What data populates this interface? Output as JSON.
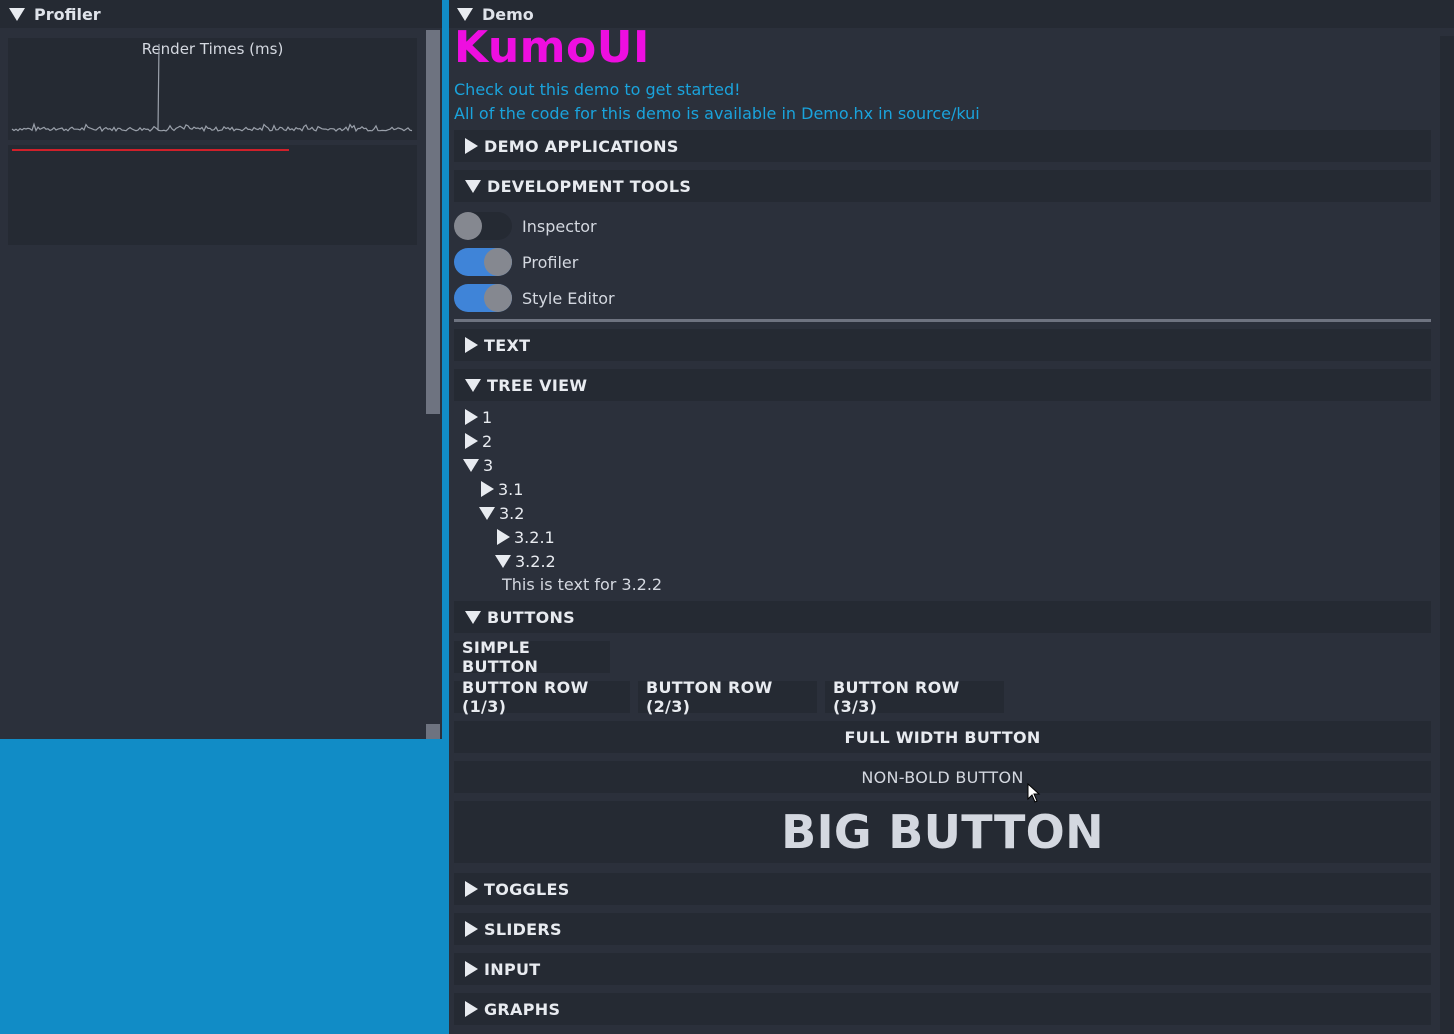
{
  "profiler": {
    "title": "Profiler",
    "graph_title": "Render Times (ms)"
  },
  "demo": {
    "title": "Demo",
    "heading": "KumoUI",
    "intro_1": "Check out this demo to get started!",
    "intro_2": "All of the code for this demo is available in Demo.hx in source/kui",
    "sections": {
      "demo_applications": "DEMO APPLICATIONS",
      "development_tools": "DEVELOPMENT TOOLS",
      "text": "TEXT",
      "tree_view": "TREE VIEW",
      "buttons": "BUTTONS",
      "toggles": "TOGGLES",
      "sliders": "SLIDERS",
      "input": "INPUT",
      "graphs": "GRAPHS"
    },
    "dev_tools": {
      "inspector": "Inspector",
      "profiler": "Profiler",
      "style_editor": "Style Editor",
      "inspector_on": false,
      "profiler_on": true,
      "style_editor_on": true
    },
    "tree": {
      "n1": "1",
      "n2": "2",
      "n3": "3",
      "n3_1": "3.1",
      "n3_2": "3.2",
      "n3_2_1": "3.2.1",
      "n3_2_2": "3.2.2",
      "n3_2_2_text": "This is text for 3.2.2"
    },
    "buttons": {
      "simple": "SIMPLE BUTTON",
      "row1": "BUTTON ROW (1/3)",
      "row2": "BUTTON ROW (2/3)",
      "row3": "BUTTON ROW (3/3)",
      "full_width": "FULL WIDTH BUTTON",
      "non_bold": "NON-BOLD BUTTON",
      "big": "BIG BUTTON"
    }
  },
  "colors": {
    "background": "#118cc6",
    "window": "#2b303b",
    "title_bar": "#252a33",
    "heading": "#ee0ee0",
    "link": "#1aa3dc",
    "toggle_on": "#3f84d8",
    "graph_line": "#9aa0aa",
    "threshold_line": "#d0202a"
  }
}
